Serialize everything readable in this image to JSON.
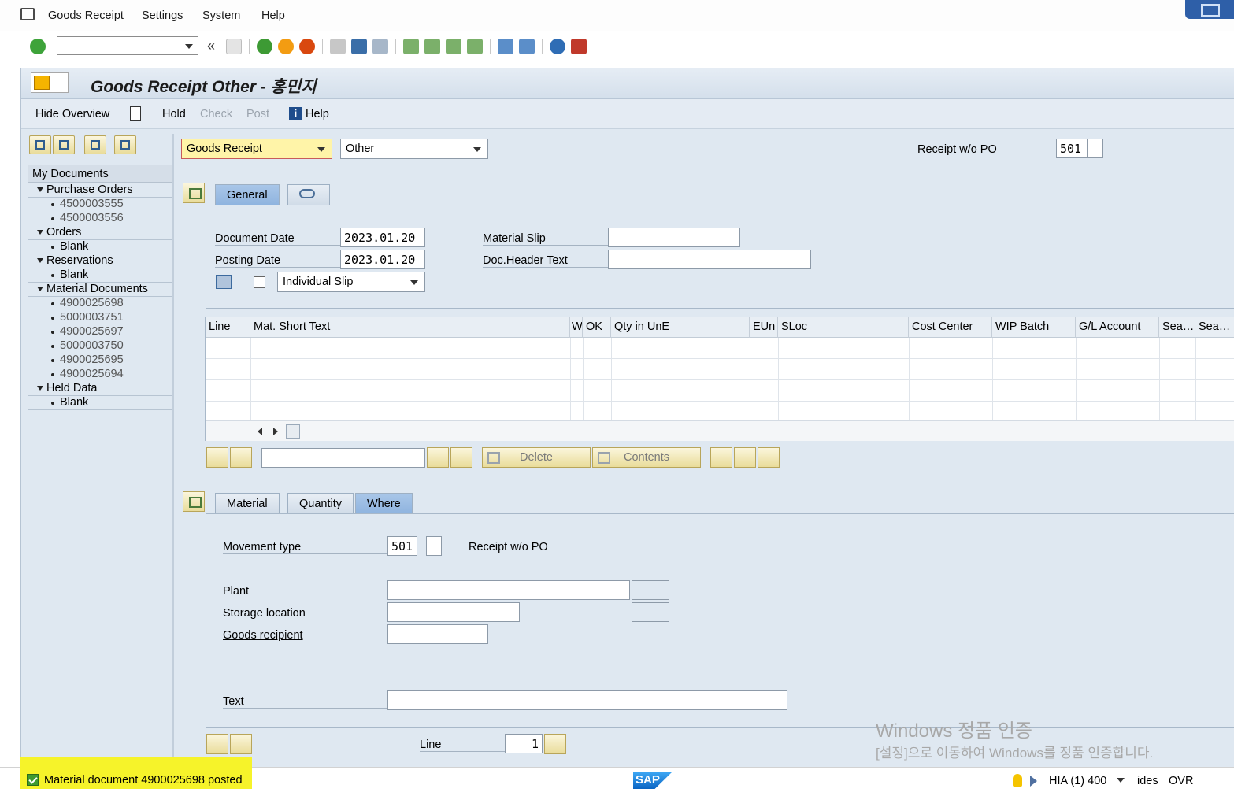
{
  "menu": {
    "items": [
      "Goods Receipt",
      "Settings",
      "System",
      "Help"
    ]
  },
  "toolbar": {
    "command_field_value": "",
    "icons": [
      "enter-icon",
      "save-icon",
      "back-icon",
      "exit-icon",
      "cancel-icon",
      "print-icon",
      "find-icon",
      "find-next-icon",
      "first-page-icon",
      "prev-page-icon",
      "next-page-icon",
      "last-page-icon",
      "new-session-icon",
      "shortcut-icon",
      "help-icon",
      "customize-icon"
    ]
  },
  "title": {
    "text": "Goods Receipt Other - 홍민지"
  },
  "app_toolbar": {
    "hide_overview": "Hide Overview",
    "hold": "Hold",
    "check": "Check",
    "post": "Post",
    "help": "Help"
  },
  "tree": {
    "header": "My Documents",
    "groups": [
      {
        "label": "Purchase Orders",
        "items": [
          "4500003555",
          "4500003556"
        ]
      },
      {
        "label": "Orders",
        "items": [
          "Blank"
        ]
      },
      {
        "label": "Reservations",
        "items": [
          "Blank"
        ]
      },
      {
        "label": "Material Documents",
        "items": [
          "4900025698",
          "5000003751",
          "4900025697",
          "5000003750",
          "4900025695",
          "4900025694"
        ]
      },
      {
        "label": "Held Data",
        "items": [
          "Blank"
        ]
      }
    ]
  },
  "header": {
    "transaction": "Goods Receipt",
    "reference": "Other",
    "receipt_label": "Receipt w/o PO",
    "movement_type": "501"
  },
  "general_tab": {
    "tabs": [
      "General"
    ],
    "document_date_label": "Document Date",
    "document_date": "2023.01.20",
    "posting_date_label": "Posting Date",
    "posting_date": "2023.01.20",
    "slip_type": "Individual Slip",
    "material_slip_label": "Material Slip",
    "material_slip": "",
    "doc_header_text_label": "Doc.Header Text",
    "doc_header_text": ""
  },
  "grid": {
    "columns": [
      "Line",
      "Mat. Short Text",
      "W",
      "OK",
      "Qty in UnE",
      "EUn",
      "SLoc",
      "Cost Center",
      "WIP Batch",
      "G/L Account",
      "Sea…",
      "Sea…"
    ],
    "rows": [
      [],
      [],
      [],
      []
    ]
  },
  "grid_toolbar": {
    "search_value": "",
    "delete": "Delete",
    "contents": "Contents"
  },
  "detail_tabs": {
    "tabs": [
      "Material",
      "Quantity",
      "Where"
    ],
    "active": "Where"
  },
  "where_tab": {
    "movement_type_label": "Movement type",
    "movement_type": "501",
    "movement_type_text": "Receipt w/o PO",
    "plant_label": "Plant",
    "plant": "",
    "storage_location_label": "Storage location",
    "storage_location": "",
    "goods_recipient_label": "Goods recipient",
    "goods_recipient": "",
    "text_label": "Text",
    "text": "",
    "line_label": "Line",
    "line_value": "1"
  },
  "status": {
    "message": "Material document 4900025698 posted",
    "system": "HIA (1) 400",
    "server": "ides",
    "mode": "OVR"
  },
  "watermark": {
    "line1": "Windows 정품 인증",
    "line2": "[설정]으로 이동하여 Windows를 정품 인증합니다."
  },
  "colors": {
    "background": "#dfe8f1",
    "highlight": "#f6f32a",
    "active_tab": "#a9c6e8",
    "button": "#e9dc9a"
  }
}
